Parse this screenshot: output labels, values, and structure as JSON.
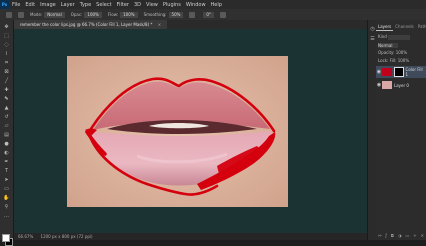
{
  "app": {
    "logo": "Ps"
  },
  "menu": [
    "File",
    "Edit",
    "Image",
    "Layer",
    "Type",
    "Select",
    "Filter",
    "3D",
    "View",
    "Plugins",
    "Window",
    "Help"
  ],
  "options": {
    "preset_label": "Mode:",
    "mode_value": "Normal",
    "opacity_label": "Opac:",
    "opacity_value": "100%",
    "flow_label": "Flow:",
    "flow_value": "100%",
    "smoothing_label": "Smoothing:",
    "smoothing_value": "50%",
    "angle_value": "0°"
  },
  "document": {
    "tab_title": "remember the color lips.jpg @ 66.7% (Color Fill 1, Layer Mask/8) *",
    "close": "×"
  },
  "status": {
    "zoom": "66.67%",
    "info": "1200 px x 800 px (72 ppi)"
  },
  "panel": {
    "tabs": [
      "Layers",
      "Channels",
      "Paths"
    ],
    "kind_label": "Kind",
    "blend_mode": "Normal",
    "opacity_label": "Opacity: 100%",
    "lock_label": "Lock:",
    "fill_label": "Fill: 100%",
    "layers": [
      {
        "name": "Color Fill 1",
        "selected": true,
        "visible": true
      },
      {
        "name": "Layer 0",
        "selected": false,
        "visible": true
      }
    ],
    "bottom_icons": [
      "link-icon",
      "fx-icon",
      "mask-icon",
      "adjustment-icon",
      "folder-icon",
      "new-layer-icon",
      "trash-icon"
    ]
  },
  "colors": {
    "accent": "#31a8ff",
    "workspace": "#1b3332",
    "outline": "#d4000e"
  }
}
